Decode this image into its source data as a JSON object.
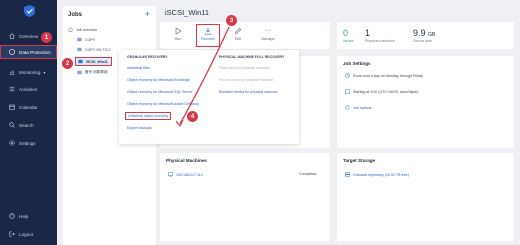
{
  "sidebar": {
    "items": [
      {
        "label": "Overview",
        "icon": "home-icon"
      },
      {
        "label": "Data Protection",
        "icon": "shield-icon"
      },
      {
        "label": "Monitoring",
        "icon": "chart-icon",
        "chevron": "▾"
      },
      {
        "label": "Activities",
        "icon": "list-icon"
      },
      {
        "label": "Calendar",
        "icon": "calendar-icon"
      },
      {
        "label": "Search",
        "icon": "search-icon"
      },
      {
        "label": "Settings",
        "icon": "gear-icon"
      }
    ],
    "bottom": [
      {
        "label": "Help",
        "icon": "help-icon"
      },
      {
        "label": "Logout",
        "icon": "logout-icon"
      }
    ]
  },
  "jobs": {
    "heading": "Jobs",
    "add": "+",
    "tree": [
      "Job overview",
      "COPY",
      "COPY VM TO C",
      "iSCSI_Win11",
      "备份 到新群组"
    ]
  },
  "main": {
    "title": "iSCSI_Win11",
    "toolbar": [
      {
        "label": "Run",
        "icon": "play-icon"
      },
      {
        "label": "Recover",
        "icon": "download-icon"
      },
      {
        "label": "Edit",
        "icon": "edit-icon"
      },
      {
        "label": "Manage",
        "icon": "more-icon",
        "glyph": "···"
      }
    ],
    "stats": [
      {
        "value": "0",
        "label": "Issues"
      },
      {
        "value": "1",
        "label": "Physical machines"
      },
      {
        "value": "9.9",
        "unit": "GB",
        "label": "Source size"
      }
    ]
  },
  "menu": {
    "granular_heading": "GRANULAR RECOVERY",
    "full_heading": "PHYSICAL MACHINE FULL RECOVERY",
    "granular": [
      "Individual files",
      "Object recovery for Microsoft Exchange",
      "Object recovery for Microsoft SQL Server",
      "Object recovery for Microsoft Active Directory",
      "Universal object recovery",
      "Export backups"
    ],
    "full": [
      "Flash boot for physical machine",
      "Full recovery for physical machine",
      "Bootable media for physical machine"
    ]
  },
  "job_settings": {
    "title": "Job Settings",
    "rows": [
      "Runs once a day on Monday through Friday",
      "Starting at 3:00 (UTC+08:00, Asia/Taipei)",
      "Job options"
    ]
  },
  "physical_machines": {
    "title": "Physical Machines",
    "name": "192.168.217.112",
    "status": "Completed"
  },
  "target_storage": {
    "title": "Target Storage",
    "name": "Onboard repository (10.92 TB free)"
  },
  "callouts": [
    "1",
    "2",
    "3",
    "4"
  ],
  "colors": {
    "sidebar": "#1a2746",
    "accent": "#2f6fd8",
    "callout": "#d63a4a",
    "issues": "#2fae5e"
  }
}
